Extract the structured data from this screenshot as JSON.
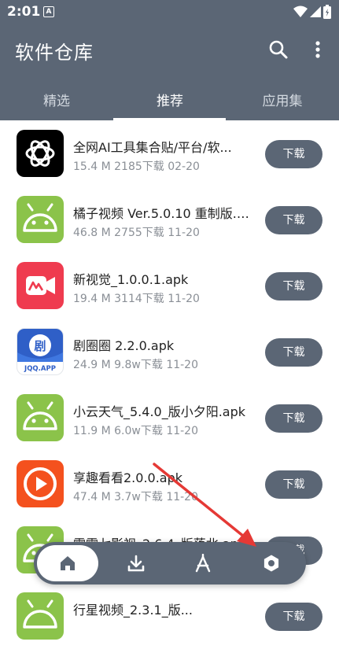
{
  "status_bar": {
    "time": "2:01",
    "notification_letter": "A"
  },
  "header": {
    "title": "软件仓库"
  },
  "tabs": [
    {
      "label": "精选",
      "active": false
    },
    {
      "label": "推荐",
      "active": true
    },
    {
      "label": "应用集",
      "active": false
    }
  ],
  "apps": [
    {
      "name": "全网AI工具集合贴/平台/软...",
      "meta": "15.4 M  2185下载  02-20",
      "button": "下载",
      "icon": "openai-logo-icon"
    },
    {
      "name": "橘子视频 Ver.5.0.10 重制版.a...",
      "meta": "46.8 M  2755下载  11-20",
      "button": "下载",
      "icon": "android-icon"
    },
    {
      "name": "新视觉_1.0.0.1.apk",
      "meta": "19.4 M  3114下载  11-20",
      "button": "下载",
      "icon": "video-app-icon"
    },
    {
      "name": "剧圈圈 2.2.0.apk",
      "meta": "24.9 M  9.8w下载  11-20",
      "button": "下载",
      "icon": "jqq-app-icon",
      "icon_text": "JQQ.APP",
      "icon_glyph": "剧"
    },
    {
      "name": "小云天气_5.4.0_版小夕阳.apk",
      "meta": "11.9 M  6.0w下载  11-20",
      "button": "下载",
      "icon": "android-icon"
    },
    {
      "name": "享趣看看2.0.0.apk",
      "meta": "47.4 M  3.7w下载  11-20",
      "button": "下载",
      "icon": "play-app-icon"
    },
    {
      "name": "零零七影视_2.6.4_版落北.apk",
      "meta": "",
      "button": "下载",
      "icon": "android-icon"
    },
    {
      "name": "行星视频_2.3.1_版...",
      "meta": "",
      "button": "下载",
      "icon": "android-icon"
    }
  ],
  "bottom_nav": [
    {
      "name": "home",
      "icon": "home-icon",
      "active": true
    },
    {
      "name": "download",
      "icon": "download-icon",
      "active": false
    },
    {
      "name": "apps",
      "icon": "app-store-icon",
      "active": false
    },
    {
      "name": "settings",
      "icon": "settings-icon",
      "active": false
    }
  ],
  "colors": {
    "primary": "#5b6675",
    "on_primary": "#ffffff",
    "meta_text": "#8a8f96",
    "annotation_arrow": "#e53935"
  }
}
